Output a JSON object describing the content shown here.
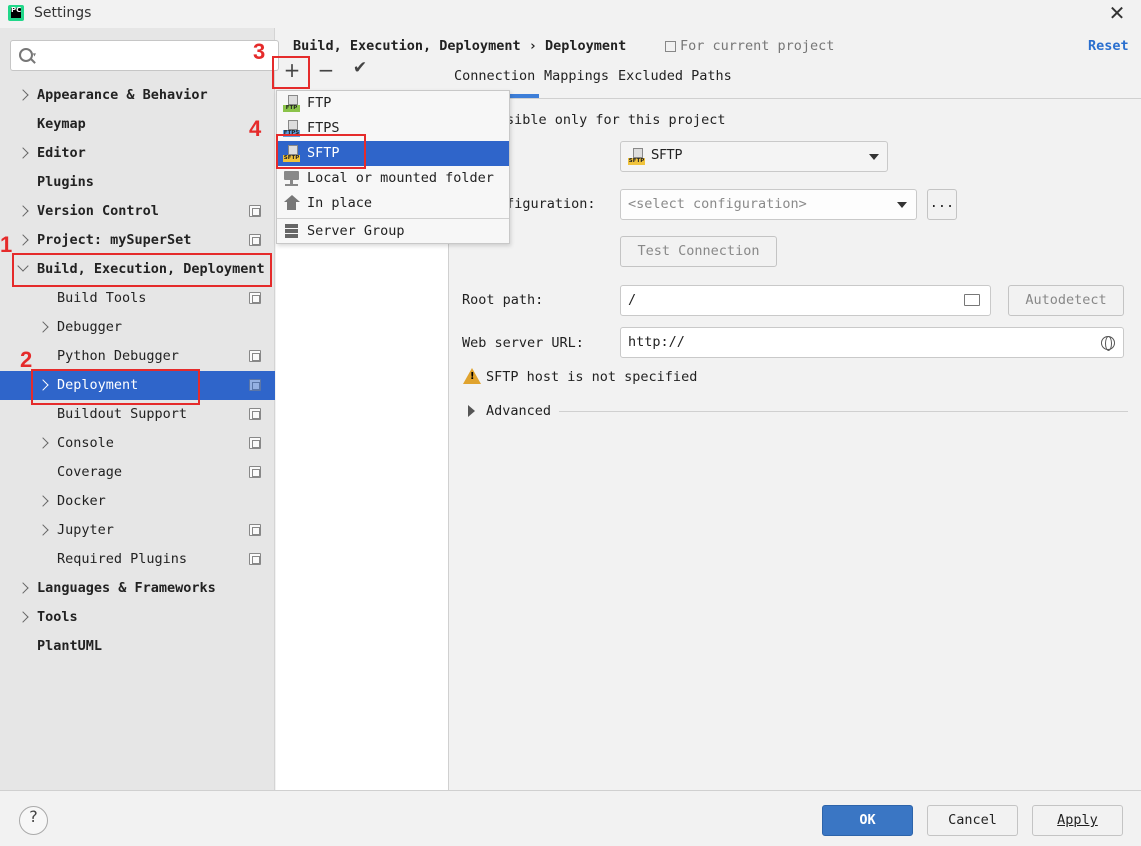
{
  "window": {
    "title": "Settings"
  },
  "search": {
    "placeholder": "",
    "dropdown_glyph": "▾"
  },
  "sidebar": {
    "items": [
      {
        "label": "Appearance & Behavior",
        "expander": "collapsed"
      },
      {
        "label": "Keymap"
      },
      {
        "label": "Editor",
        "expander": "collapsed"
      },
      {
        "label": "Plugins"
      },
      {
        "label": "Version Control",
        "expander": "collapsed",
        "project_icon": true
      },
      {
        "label": "Project: mySuperSet",
        "expander": "collapsed",
        "project_icon": true
      },
      {
        "label": "Build, Execution, Deployment",
        "expander": "expanded"
      },
      {
        "label": "Build Tools",
        "project_icon": true
      },
      {
        "label": "Debugger",
        "expander": "collapsed"
      },
      {
        "label": "Python Debugger",
        "project_icon": true
      },
      {
        "label": "Deployment",
        "expander": "collapsed",
        "selected": true,
        "project_icon": true
      },
      {
        "label": "Buildout Support",
        "project_icon": true
      },
      {
        "label": "Console",
        "expander": "collapsed",
        "project_icon": true
      },
      {
        "label": "Coverage",
        "project_icon": true
      },
      {
        "label": "Docker",
        "expander": "collapsed"
      },
      {
        "label": "Jupyter",
        "expander": "collapsed",
        "project_icon": true
      },
      {
        "label": "Required Plugins",
        "project_icon": true
      },
      {
        "label": "Languages & Frameworks",
        "expander": "collapsed"
      },
      {
        "label": "Tools",
        "expander": "collapsed"
      },
      {
        "label": "PlantUML"
      }
    ]
  },
  "annotations": {
    "n1": "1",
    "n2": "2",
    "n3": "3",
    "n4": "4",
    "color": "#e52b2b"
  },
  "toolbar": {
    "add_glyph": "+",
    "remove_glyph": "−",
    "apply_glyph": "✔"
  },
  "popup": {
    "items": [
      {
        "label": "FTP",
        "icon": "ftp-icon",
        "badge": "FTP",
        "badge_color": "#8bc34a"
      },
      {
        "label": "FTPS",
        "icon": "ftps-icon",
        "badge": "FTPS",
        "badge_color": "#5e9ee0"
      },
      {
        "label": "SFTP",
        "icon": "sftp-icon",
        "badge": "SFTP",
        "badge_color": "#f0c33c",
        "selected": true
      },
      {
        "label": "Local or mounted folder",
        "icon": "folder-server-icon"
      },
      {
        "label": "In place",
        "icon": "home-icon"
      },
      {
        "label": "Server Group",
        "icon": "server-group-icon"
      }
    ]
  },
  "header": {
    "breadcrumb": "Build, Execution, Deployment › Deployment",
    "scope": "For current project",
    "reset": "Reset"
  },
  "tabs": [
    "Connection",
    "Mappings",
    "Excluded Paths"
  ],
  "form": {
    "visible_only": "sible only for this project",
    "type_value": "SFTP",
    "ssh_config_label": "nfiguration:",
    "ssh_config_placeholder": "<select configuration>",
    "browse_label": "...",
    "test_connection": "Test Connection",
    "root_path_label": "Root path:",
    "root_path_value": "/",
    "autodetect": "Autodetect",
    "web_url_label": "Web server URL:",
    "web_url_value": "http://",
    "warning": "SFTP host is not specified",
    "advanced": "Advanced"
  },
  "footer": {
    "help": "?",
    "ok": "OK",
    "cancel": "Cancel",
    "apply": "Apply"
  },
  "colors": {
    "selection": "#2f65ca",
    "accent": "#3d7ed8",
    "link": "#2a6fcf",
    "warning": "#e0a32e"
  }
}
